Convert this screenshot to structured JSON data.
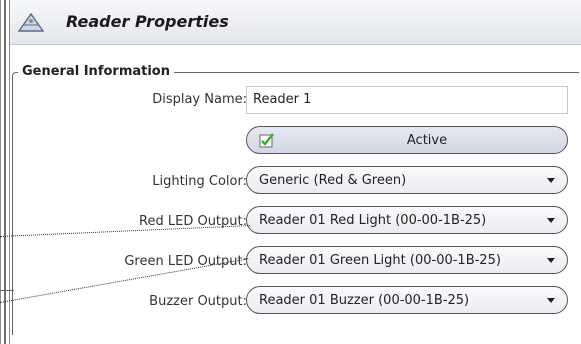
{
  "header": {
    "title": "Reader Properties",
    "icon": "reader-icon"
  },
  "group": {
    "title": "General Information"
  },
  "fields": {
    "display_name": {
      "label": "Display Name:",
      "value": "Reader 1"
    },
    "active": {
      "label": "Active",
      "checked": true
    },
    "lighting_color": {
      "label": "Lighting Color:",
      "value": "Generic (Red & Green)"
    },
    "red_led": {
      "label": "Red LED Output:",
      "value": "Reader 01 Red Light (00-00-1B-25)"
    },
    "green_led": {
      "label": "Green LED Output:",
      "value": "Reader 01 Green Light (00-00-1B-25)"
    },
    "buzzer": {
      "label": "Buzzer Output:",
      "value": "Reader 01 Buzzer (00-00-1B-25)"
    }
  },
  "colors": {
    "check_green": "#3fa535",
    "border": "#555555",
    "header_bg": "#e4e7ec"
  }
}
